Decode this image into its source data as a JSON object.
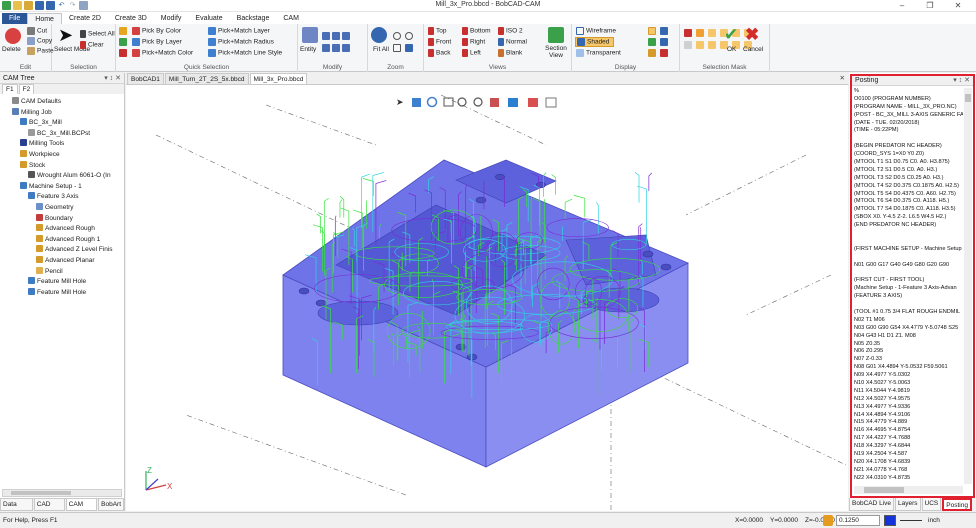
{
  "window": {
    "title": "Mill_3x_Pro.bbcd - BobCAD-CAM",
    "controls": [
      "–",
      "❐",
      "✕"
    ]
  },
  "ribbon_tabs": [
    "File",
    "Home",
    "Create 2D",
    "Create 3D",
    "Modify",
    "Evaluate",
    "Backstage",
    "CAM"
  ],
  "ribbon": {
    "edit": {
      "label": "Edit",
      "delete": "Delete",
      "cut": "Cut",
      "copy": "Copy",
      "paste": "Paste"
    },
    "selection": {
      "label": "Selection",
      "select_mode": "Select Mode",
      "select_all": "Select All",
      "clear": "Clear"
    },
    "quick_selection": {
      "label": "Quick Selection",
      "items": [
        "Pick By Color",
        "Pick By Layer",
        "Pick+Match Color",
        "Pick+Match Layer",
        "Pick+Match Radius",
        "Pick+Match Line Style"
      ]
    },
    "modify": {
      "label": "Modify",
      "entity": "Entity"
    },
    "zoom": {
      "label": "Zoom",
      "fit_all": "Fit All"
    },
    "views": {
      "label": "Views",
      "items": [
        "Top",
        "Front",
        "Back",
        "Bottom",
        "Right",
        "Left",
        "ISO 2",
        "Normal",
        "Blank"
      ],
      "section_view": "Section View"
    },
    "display": {
      "label": "Display",
      "items": [
        "Wireframe",
        "Shaded",
        "Transparent"
      ]
    },
    "selection_mask": {
      "label": "Selection Mask",
      "ok": "OK",
      "cancel": "Cancel"
    }
  },
  "cam_tree": {
    "title": "CAM Tree",
    "controls": "▾ ↕ ✕",
    "tabs": [
      "F1",
      "F2"
    ],
    "items": [
      {
        "label": "CAM Defaults",
        "indent": 1,
        "color": "#8a8a8a"
      },
      {
        "label": "Milling Job",
        "indent": 1,
        "color": "#5a7fb5"
      },
      {
        "label": "BC_3x_Mill",
        "indent": 2,
        "color": "#3d7bc4"
      },
      {
        "label": "BC_3x_Mill.BCPst",
        "indent": 3,
        "color": "#9a9a9a"
      },
      {
        "label": "Milling Tools",
        "indent": 2,
        "color": "#2c3e8f"
      },
      {
        "label": "Workpiece",
        "indent": 2,
        "color": "#d49a2a"
      },
      {
        "label": "Stock",
        "indent": 2,
        "color": "#d49a2a"
      },
      {
        "label": "Wrought Alum 6061-O (In",
        "indent": 3,
        "color": "#555555"
      },
      {
        "label": "Machine Setup - 1",
        "indent": 2,
        "color": "#3d7bc4"
      },
      {
        "label": "Feature 3 Axis",
        "indent": 3,
        "color": "#3d7bc4"
      },
      {
        "label": "Geometry",
        "indent": 4,
        "color": "#6b8fc9"
      },
      {
        "label": "Boundary",
        "indent": 4,
        "color": "#c43d3d"
      },
      {
        "label": "Advanced Rough",
        "indent": 4,
        "color": "#d49a2a"
      },
      {
        "label": "Advanced Rough 1",
        "indent": 4,
        "color": "#d49a2a"
      },
      {
        "label": "Advanced Z Level Finis",
        "indent": 4,
        "color": "#d49a2a"
      },
      {
        "label": "Advanced Planar",
        "indent": 4,
        "color": "#d49a2a"
      },
      {
        "label": "Pencil",
        "indent": 4,
        "color": "#e0b050"
      },
      {
        "label": "Feature Mill Hole",
        "indent": 3,
        "color": "#3d7bc4"
      },
      {
        "label": "Feature Mill Hole",
        "indent": 3,
        "color": "#3d7bc4"
      }
    ],
    "bottom_tabs": [
      "Data Entry",
      "CAD Tree",
      "CAM Tree",
      "BobArt"
    ]
  },
  "documents": {
    "tabs": [
      "BobCAD1",
      "Mill_Turn_2T_2S_5x.bbcd",
      "Mill_3x_Pro.bbcd"
    ],
    "active_index": 2,
    "close": "✕"
  },
  "viewport": {
    "axis_z": "Z",
    "axis_x": "X",
    "part_color": "#6f73e8",
    "toolpath_colors": [
      "#34e33a",
      "#2fd4e0",
      "#7a2bd8"
    ]
  },
  "posting": {
    "title": "Posting",
    "controls": "▾ ↕ ✕",
    "lines": [
      "%",
      "O0100 (PROGRAM NUMBER)",
      "(PROGRAM NAME - MILL_3X_PRO.NC)",
      "(POST - BC_3X_MILL 3-AXIS GENERIC FA",
      "(DATE - TUE. 02/20/2018)",
      "(TIME - 05:22PM)",
      "",
      "(BEGIN PREDATOR NC HEADER)",
      "(COORD_SYS 1=X0 Y0 Z0)",
      "(MTOOL T1 S1 D0.75 C0. A0. H3.875)",
      "(MTOOL T2 S1 D0.5 C0. A0. H3.)",
      "(MTOOL T3 S2 D0.5 C0.25 A0. H3.)",
      "(MTOOL T4 S2 D0.375 C0.1875 A0. H2.5)",
      "(MTOOL T5 S4 D0.4375 C0. A60. H2.75)",
      "(MTOOL T6 S4 D0.375 C0. A118. H5.)",
      "(MTOOL T7 S4 D0.1875 C0. A118. H3.5)",
      "(SBOX X0. Y-4.5 Z-2. L6.5 W4.5 H2.)",
      "(END PREDATOR NC HEADER)",
      "",
      "",
      "(FIRST MACHINE SETUP - Machine Setup",
      "",
      "N01 G00 G17 G40 G49 G80 G20 G90",
      "",
      "(FIRST CUT - FIRST TOOL)",
      "(Machine Setup - 1-Feature 3 Axis-Advan",
      "(FEATURE 3 AXIS)",
      "",
      "(TOOL #1 0.75 3/4 FLAT ROUGH ENDMIL",
      "N02 T1 M06",
      "N03 G00 G90 G54 X4.4779 Y-5.0748 S25",
      "N04 G43 H1 D1 Z1. M08",
      "N05 Z0.35",
      "N06 Z0.295",
      "N07 Z-0.33",
      "N08 G01 X4.4894 Y-5.0532 F59.5061",
      "N09 X4.4977 Y-5.0302",
      "N10 X4.5027 Y-5.0063",
      "N11 X4.5044 Y-4.9819",
      "N12 X4.5027 Y-4.9575",
      "N13 X4.4977 Y-4.9336",
      "N14 X4.4894 Y-4.9106",
      "N15 X4.4779 Y-4.889",
      "N16 X4.4695 Y-4.8754",
      "N17 X4.4227 Y-4.7688",
      "N18 X4.3297 Y-4.6844",
      "N19 X4.2504 Y-4.587",
      "N20 X4.1708 Y-4.6839",
      "N21 X4.0778 Y-4.768",
      "N22 X4.0310 Y-4.8735"
    ],
    "bottom_tabs": [
      "BobCAD Live",
      "Layers",
      "UCS",
      "Posting"
    ]
  },
  "status": {
    "message": "For Help, Press F1",
    "x": "X=0.0000",
    "y": "Y=0.0000",
    "z": "Z=-0.0000",
    "tolerance": "0.1250",
    "units": "inch"
  }
}
